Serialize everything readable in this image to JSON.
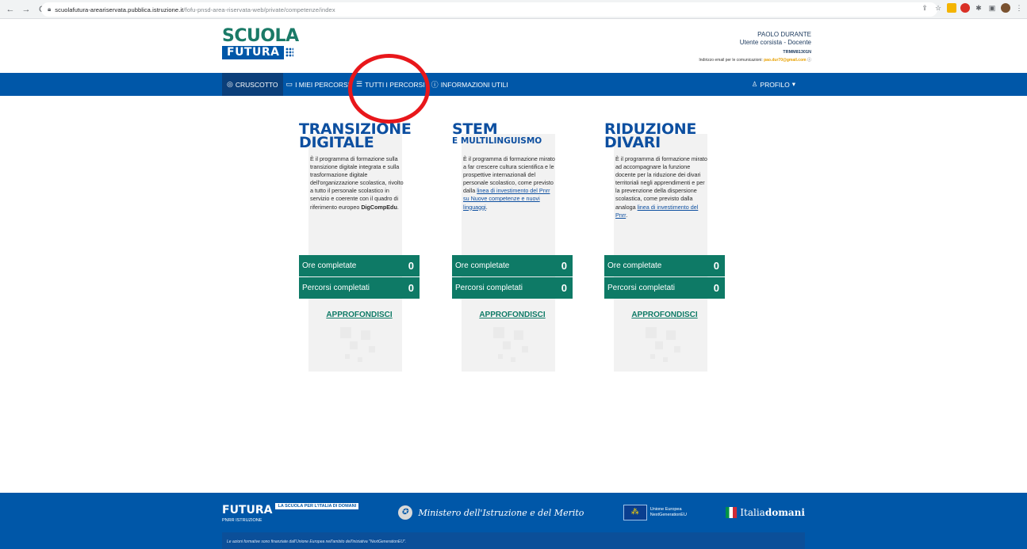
{
  "browser": {
    "back_icon": "←",
    "forward_icon": "→",
    "reload_icon": "C",
    "url_host": "scuolafutura-areariservata.pubblica.istruzione.it",
    "url_path": "/fofu-pnsd-area-riservata-web/private/competenze/index"
  },
  "header": {
    "logo_line1": "SCUOLA",
    "logo_line2": "FUTURA",
    "user_name": "PAOLO DURANTE",
    "user_role": "Utente corsista - Docente",
    "user_code": "TRMM81301N",
    "email_label": "Indirizzo email per le comunicazioni:",
    "email_value": "pao.dur70@gmail.com"
  },
  "nav": {
    "items": [
      {
        "label": "CRUSCOTTO",
        "icon": "◎"
      },
      {
        "label": "I MIEI PERCORSI",
        "icon": "▭"
      },
      {
        "label": "TUTTI I PERCORSI",
        "icon": "☰"
      },
      {
        "label": "INFORMAZIONI UTILI",
        "icon": "ⓘ"
      }
    ],
    "profile_label": "PROFILO",
    "profile_icon": "♙"
  },
  "cards": [
    {
      "title1": "TRANSIZIONE",
      "title2": "DIGITALE",
      "subtitle": "",
      "desc_text": "È il programma di formazione sulla transizione digitale integrata e sulla trasformazione digitale dell'organizzazione scolastica, rivolto a tutto il personale scolastico in servizio e coerente con il quadro di riferimento europeo",
      "desc_link": "",
      "desc_bold": "DigCompEdu",
      "desc_end": ".",
      "ore_label": "Ore completate",
      "ore_value": "0",
      "percorsi_label": "Percorsi completati",
      "percorsi_value": "0",
      "more_label": "APPROFONDISCI"
    },
    {
      "title1": "STEM",
      "title2": "",
      "subtitle": "E MULTILINGUISMO",
      "desc_text": "È il programma di formazione mirato a far crescere cultura scientifica e le prospettive internazionali del personale scolastico, come previsto dalla",
      "desc_link": "linea di investimento del Pnrr su Nuove competenze e nuovi linguaggi",
      "desc_bold": "",
      "desc_end": ".",
      "ore_label": "Ore completate",
      "ore_value": "0",
      "percorsi_label": "Percorsi completati",
      "percorsi_value": "0",
      "more_label": "APPROFONDISCI"
    },
    {
      "title1": "RIDUZIONE",
      "title2": "DIVARI",
      "subtitle": "",
      "desc_text": "È il programma di formazione mirato ad accompagnare la funzione docente per la riduzione dei divari territoriali negli apprendimenti e per la prevenzione della dispersione scolastica, come previsto dalla analoga",
      "desc_link": "linea di investimento del Pnrr",
      "desc_bold": "",
      "desc_end": ".",
      "ore_label": "Ore completate",
      "ore_value": "0",
      "percorsi_label": "Percorsi completati",
      "percorsi_value": "0",
      "more_label": "APPROFONDISCI"
    }
  ],
  "footer": {
    "futura": "FUTURA",
    "futura_sub": "PNRR ISTRUZIONE",
    "futura_tag": "LA SCUOLA PER L'ITALIA DI DOMANI",
    "ministry": "Ministero dell'Istruzione e del Merito",
    "eu_line1": "Unione Europea",
    "eu_line2": "NextGenerationEU",
    "italia_prefix": "Italia",
    "italia_suffix": "domani",
    "note": "Le azioni formative sono finanziate dall'Unione Europea nell'ambito dell'iniziativa \"NextGenerationEU\"."
  },
  "colors": {
    "nav_blue": "#0057a8",
    "stat_green": "#0e7a66",
    "title_blue": "#0d4fa0",
    "annotation_red": "#e8171b"
  }
}
